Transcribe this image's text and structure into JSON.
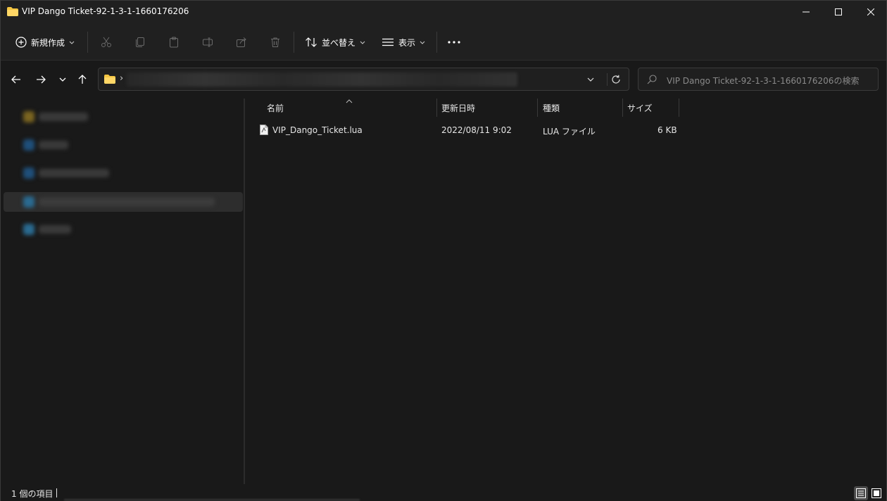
{
  "window": {
    "title": "VIP Dango Ticket-92-1-3-1-1660176206",
    "controls": {
      "minimize_icon": "minimize-icon",
      "maximize_icon": "maximize-icon",
      "close_icon": "close-icon"
    }
  },
  "toolbar": {
    "new_label": "新規作成",
    "sort_label": "並べ替え",
    "view_label": "表示",
    "icons": [
      "cut-icon",
      "copy-icon",
      "paste-icon",
      "rename-icon",
      "share-icon",
      "delete-icon",
      "more-icon"
    ]
  },
  "search": {
    "placeholder": "VIP Dango Ticket-92-1-3-1-1660176206の検索"
  },
  "columns": {
    "name": "名前",
    "date": "更新日時",
    "type": "種類",
    "size": "サイズ"
  },
  "files": [
    {
      "name": "VIP_Dango_Ticket.lua",
      "date": "2022/08/11 9:02",
      "type": "LUA ファイル",
      "size": "6 KB",
      "icon": "lua-file-icon"
    }
  ],
  "status": {
    "item_count": "1 個の項目"
  },
  "colors": {
    "background": "#191919",
    "chrome": "#202020",
    "folder": "#f4c542",
    "text": "#e6e6e6"
  }
}
